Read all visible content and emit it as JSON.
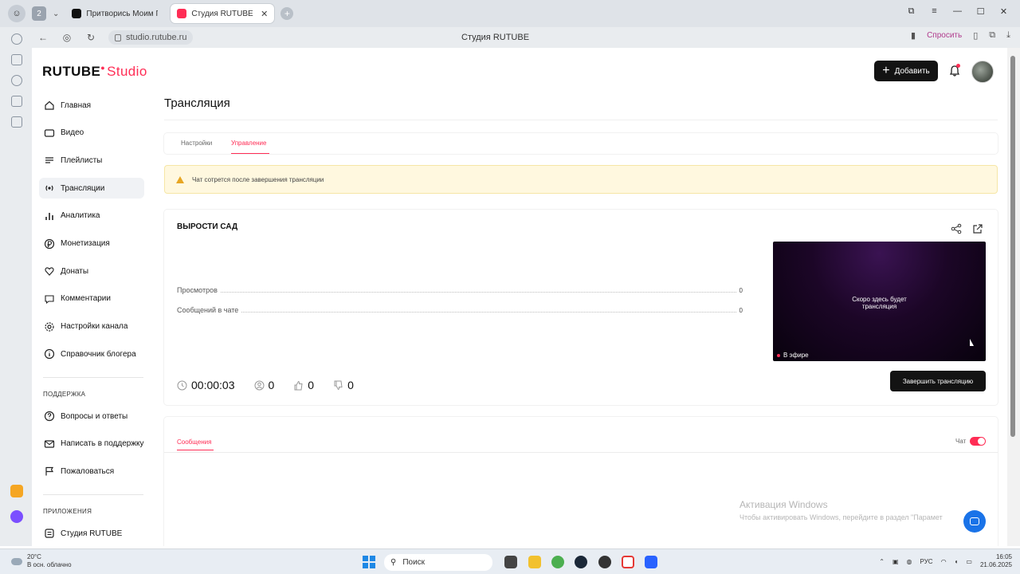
{
  "browser": {
    "tab_count": "2",
    "tabs": [
      {
        "title": "Притворись Моим Па...",
        "active": false
      },
      {
        "title": "Студия RUTUBE",
        "active": true
      }
    ],
    "url": "studio.rutube.ru",
    "page_title": "Студия RUTUBE",
    "ask_label": "Спросить"
  },
  "app": {
    "logo_main": "RUTUBE",
    "logo_sub": "Studio",
    "add_button": "Добавить"
  },
  "sidebar": {
    "items": [
      {
        "label": "Главная",
        "icon": "home-icon"
      },
      {
        "label": "Видео",
        "icon": "video-icon"
      },
      {
        "label": "Плейлисты",
        "icon": "playlist-icon"
      },
      {
        "label": "Трансляции",
        "icon": "broadcast-icon"
      },
      {
        "label": "Аналитика",
        "icon": "analytics-icon"
      },
      {
        "label": "Монетизация",
        "icon": "ruble-icon"
      },
      {
        "label": "Донаты",
        "icon": "donate-icon"
      },
      {
        "label": "Комментарии",
        "icon": "comments-icon"
      },
      {
        "label": "Настройки канала",
        "icon": "gear-icon"
      },
      {
        "label": "Справочник блогера",
        "icon": "book-icon"
      }
    ],
    "support_label": "ПОДДЕРЖКА",
    "support_items": [
      {
        "label": "Вопросы и ответы",
        "icon": "question-icon"
      },
      {
        "label": "Написать в поддержку",
        "icon": "mail-icon"
      },
      {
        "label": "Пожаловаться",
        "icon": "flag-icon"
      }
    ],
    "apps_label": "ПРИЛОЖЕНИЯ",
    "apps_items": [
      {
        "label": "Студия RUTUBE",
        "icon": "studio-app-icon"
      }
    ]
  },
  "main": {
    "heading": "Трансляция",
    "tabs": [
      {
        "label": "Настройки",
        "selected": false
      },
      {
        "label": "Управление",
        "selected": true
      }
    ],
    "alert": "Чат сотрется после завершения трансляции",
    "stream": {
      "title": "ВЫРОСТИ САД",
      "stats": [
        {
          "label": "Просмотров",
          "value": "0"
        },
        {
          "label": "Сообщений в чате",
          "value": "0"
        }
      ],
      "player_text_line1": "Скоро здесь будет",
      "player_text_line2": "трансляция",
      "live_label": "В эфире",
      "duration": "00:00:03",
      "viewers": "0",
      "likes": "0",
      "dislikes": "0",
      "finish_button": "Завершить трансляцию"
    },
    "chat": {
      "tab_label": "Сообщения",
      "toggle_label": "Чат",
      "toggle_on": true
    }
  },
  "watermark": {
    "line1": "Активация Windows",
    "line2": "Чтобы активировать Windows, перейдите в раздел \"Парамет"
  },
  "taskbar": {
    "weather_temp": "20°C",
    "weather_desc": "В осн. облачно",
    "search_label": "Поиск",
    "language": "РУС",
    "time": "16:05",
    "date": "21.06.2025"
  },
  "colors": {
    "accent": "#ff2d55",
    "dark_button": "#131313",
    "alert_bg": "#fff8df"
  }
}
